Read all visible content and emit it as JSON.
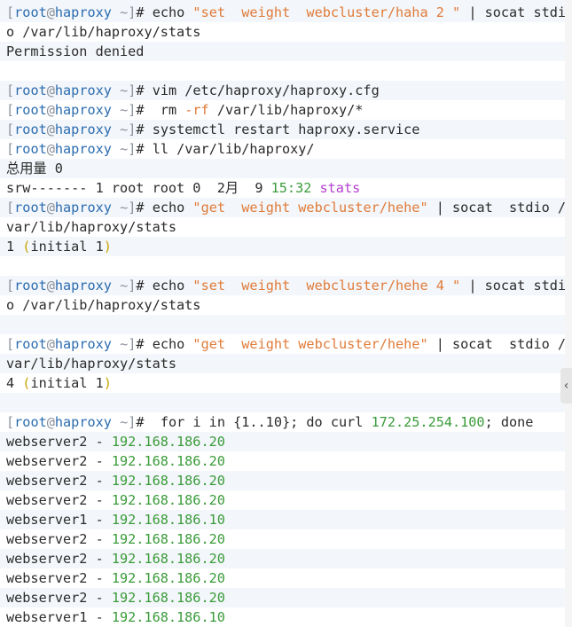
{
  "prompt": {
    "open": "[",
    "user": "root",
    "at": "@",
    "host": "haproxy",
    "dir": "~",
    "close": "]",
    "symbol": "#"
  },
  "lines": {
    "l1_cmd": "echo",
    "l1_str": "\"set  weight  webcluster/haha 2 \"",
    "l1_rest": " | socat stdi",
    "l2": "o /var/lib/haproxy/stats",
    "l3": "Permission denied",
    "l5_cmd": "vim /etc/haproxy/haproxy.cfg",
    "l6_a": " rm ",
    "l6_flag": "-rf",
    "l6_b": " /var/lib/haproxy/*",
    "l7_cmd": "systemctl restart haproxy.service",
    "l8_cmd": "ll /var/lib/haproxy/",
    "l9": "总用量 0",
    "l10_a": "srw------- 1 root root 0  2月  9 ",
    "l10_time": "15:32",
    "l10_file": "stats",
    "l11_cmd": "echo",
    "l11_str": "\"get  weight webcluster/hehe\"",
    "l11_rest": " | socat  stdio /",
    "l12": "var/lib/haproxy/stats",
    "l13_a": "1 ",
    "l13_open": "(",
    "l13_b": "initial 1",
    "l13_close": ")",
    "l15_cmd": "echo",
    "l15_str": "\"set  weight  webcluster/hehe 4 \"",
    "l15_rest": " | socat stdi",
    "l16": "o /var/lib/haproxy/stats",
    "l18_cmd": "echo",
    "l18_str": "\"get  weight webcluster/hehe\"",
    "l18_rest": " | socat  stdio /",
    "l19": "var/lib/haproxy/stats",
    "l20_a": "4 ",
    "l20_open": "(",
    "l20_b": "initial 1",
    "l20_close": ")",
    "l22_a": "  for i in {1..10}; do curl ",
    "l22_ip": "172.25.254.100",
    "l22_b": "; done"
  },
  "curl_output": [
    {
      "server": "webserver2",
      "sep": " - ",
      "ip": "192.168.186.20"
    },
    {
      "server": "webserver2",
      "sep": " - ",
      "ip": "192.168.186.20"
    },
    {
      "server": "webserver2",
      "sep": " - ",
      "ip": "192.168.186.20"
    },
    {
      "server": "webserver2",
      "sep": " - ",
      "ip": "192.168.186.20"
    },
    {
      "server": "webserver1",
      "sep": " - ",
      "ip": "192.168.186.10"
    },
    {
      "server": "webserver2",
      "sep": " - ",
      "ip": "192.168.186.20"
    },
    {
      "server": "webserver2",
      "sep": " - ",
      "ip": "192.168.186.20"
    },
    {
      "server": "webserver2",
      "sep": " - ",
      "ip": "192.168.186.20"
    },
    {
      "server": "webserver2",
      "sep": " - ",
      "ip": "192.168.186.20"
    },
    {
      "server": "webserver1",
      "sep": " - ",
      "ip": "192.168.186.10"
    }
  ],
  "side_handle": {
    "icon": "chevron-left-icon",
    "glyph": "‹"
  },
  "colors": {
    "prompt": "#2b6cb0",
    "string": "#e07b39",
    "number": "#3a9b3a",
    "file": "#b63fd1",
    "paren": "#c8a400",
    "stripe": "#f3f6fa"
  }
}
